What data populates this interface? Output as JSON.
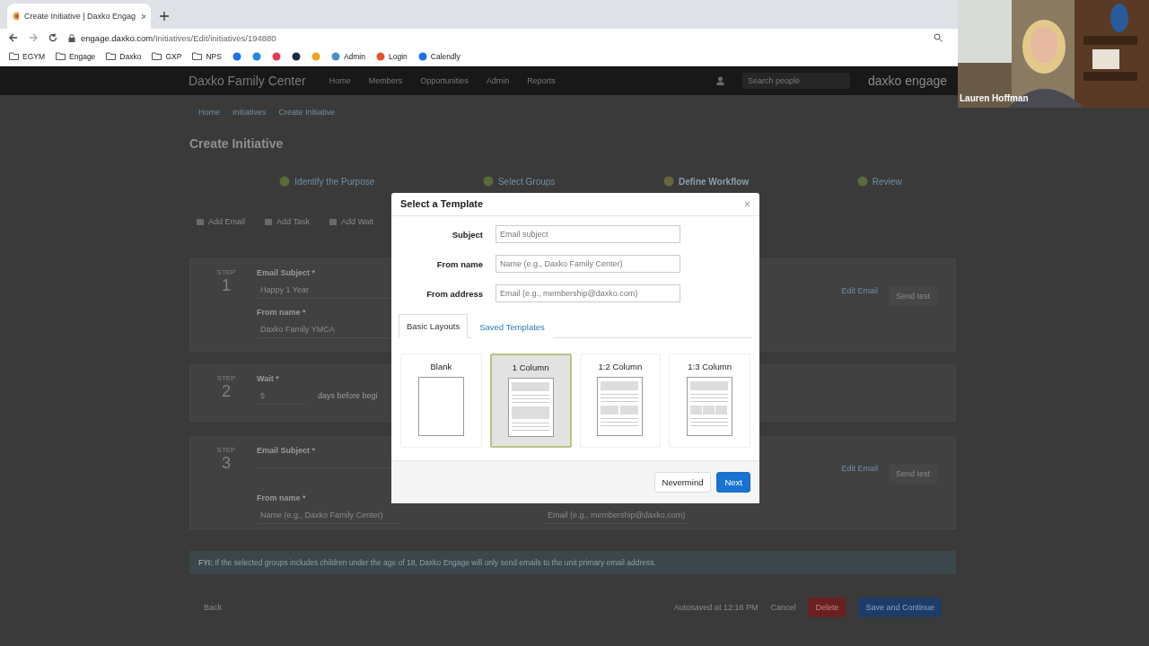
{
  "browser": {
    "tab_title": "Create Initiative | Daxko Engag",
    "url_host": "engage.daxko.com",
    "url_path": "/Initiatives/Edit/initiatives/194880",
    "bookmarks": [
      {
        "kind": "folder",
        "label": "EGYM"
      },
      {
        "kind": "folder",
        "label": "Engage"
      },
      {
        "kind": "folder",
        "label": "Daxko"
      },
      {
        "kind": "folder",
        "label": "GXP"
      },
      {
        "kind": "folder",
        "label": "NPS"
      },
      {
        "kind": "app",
        "color": "#1a73e8"
      },
      {
        "kind": "app",
        "color": "#1e88e5"
      },
      {
        "kind": "app",
        "color": "#e53950"
      },
      {
        "kind": "app",
        "color": "#1c2b45"
      },
      {
        "kind": "app",
        "color": "#f2a31b"
      },
      {
        "kind": "link",
        "label": "Admin",
        "color": "#4a90c8"
      },
      {
        "kind": "link",
        "label": "Login",
        "color": "#e8552c"
      },
      {
        "kind": "link",
        "label": "Calendly",
        "color": "#1a73e8"
      }
    ]
  },
  "video": {
    "name": "Lauren Hoffman"
  },
  "nav": {
    "brand": "Daxko Family Center",
    "items": [
      "Home",
      "Members",
      "Opportunities",
      "Admin",
      "Reports"
    ],
    "search_placeholder": "Search people",
    "logo": "daxko engage"
  },
  "breadcrumb": [
    "Home",
    "Initiatives",
    "Create Initiative"
  ],
  "title": "Create Initiative",
  "wizard": [
    {
      "label": "Identify the Purpose",
      "selected": false
    },
    {
      "label": "Select Groups",
      "selected": false
    },
    {
      "label": "Define Workflow",
      "selected": true
    },
    {
      "label": "Review",
      "selected": false
    }
  ],
  "toolbar": [
    "Add Email",
    "Add Task",
    "Add Wait"
  ],
  "steps": [
    {
      "kind": "email",
      "step_label": "STEP",
      "number": "1",
      "subject_label": "Email Subject *",
      "subject": "Happy 1 Year",
      "from_label": "From name *",
      "from": "Daxko Family YMCA",
      "actions": [
        "Edit Email",
        "Send test"
      ]
    },
    {
      "kind": "wait",
      "step_label": "STEP",
      "number": "2",
      "wait_label": "Wait *",
      "days": "5",
      "days_text": "days before begi"
    },
    {
      "kind": "email",
      "step_label": "STEP",
      "number": "3",
      "subject_label": "Email Subject *",
      "from_label": "From name *",
      "from": "Name (e.g., Daxko Family Center)",
      "address": "Email (e.g., membership@daxko.com)",
      "actions": [
        "Edit Email",
        "Send test"
      ]
    }
  ],
  "fyi": {
    "label": "FYI:",
    "text": "If the selected groups includes children under the age of 18, Daxko Engage will only send emails to the unit primary email address."
  },
  "footer": {
    "back": "Back",
    "autosaved": "Autosaved at 12:16 PM",
    "cancel": "Cancel",
    "delete": "Delete",
    "save": "Save and Continue"
  },
  "modal": {
    "title": "Select a Template",
    "close": "×",
    "fields": [
      {
        "label": "Subject",
        "placeholder": "Email subject"
      },
      {
        "label": "From name",
        "placeholder": "Name (e.g., Daxko Family Center)"
      },
      {
        "label": "From address",
        "placeholder": "Email (e.g., membership@daxko.com)"
      }
    ],
    "tabs": [
      {
        "label": "Basic Layouts",
        "selected": true
      },
      {
        "label": "Saved Templates",
        "selected": false
      }
    ],
    "templates": [
      {
        "kind": "blank",
        "label": "Blank",
        "selected": false
      },
      {
        "kind": "one",
        "label": "1 Column",
        "selected": true
      },
      {
        "kind": "two",
        "label": "1:2 Column",
        "selected": false
      },
      {
        "kind": "three",
        "label": "1:3 Column",
        "selected": false
      }
    ],
    "buttons": {
      "secondary": "Nevermind",
      "primary": "Next"
    }
  }
}
